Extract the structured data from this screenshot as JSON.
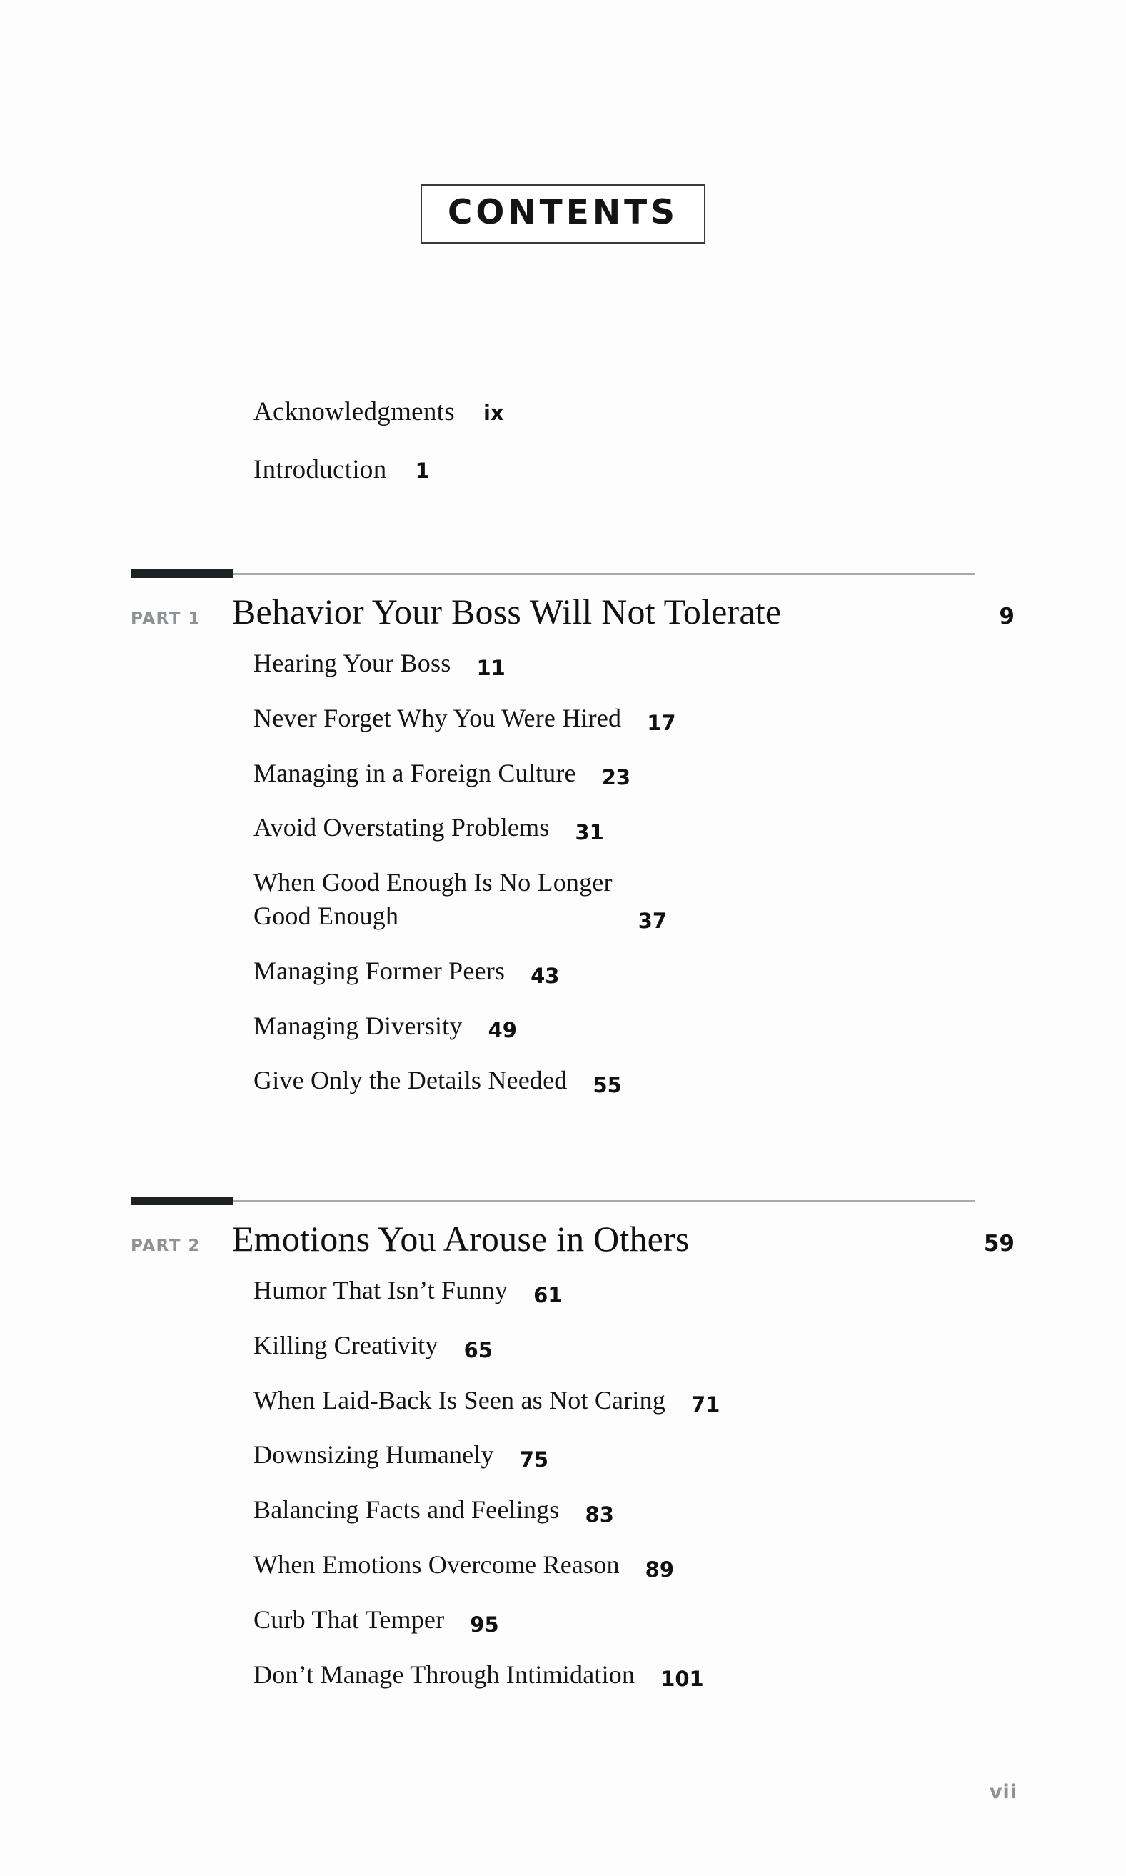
{
  "header": {
    "title": "CONTENTS"
  },
  "front_matter": [
    {
      "title": "Acknowledgments",
      "page": "ix"
    },
    {
      "title": "Introduction",
      "page": "1"
    }
  ],
  "parts": [
    {
      "label": "PART 1",
      "title": "Behavior Your Boss Will Not Tolerate",
      "page": "9",
      "chapters": [
        {
          "title": "Hearing Your Boss",
          "page": "11"
        },
        {
          "title": "Never Forget Why You Were Hired",
          "page": "17"
        },
        {
          "title": "Managing in a Foreign Culture",
          "page": "23"
        },
        {
          "title": "Avoid Overstating Problems",
          "page": "31"
        },
        {
          "title": "When Good Enough Is No Longer\nGood Enough",
          "page": "37"
        },
        {
          "title": "Managing Former Peers",
          "page": "43"
        },
        {
          "title": "Managing Diversity",
          "page": "49"
        },
        {
          "title": "Give Only the Details Needed",
          "page": "55"
        }
      ]
    },
    {
      "label": "PART 2",
      "title": "Emotions You Arouse in Others",
      "page": "59",
      "chapters": [
        {
          "title": "Humor That Isn’t Funny",
          "page": "61"
        },
        {
          "title": "Killing Creativity",
          "page": "65"
        },
        {
          "title": "When Laid-Back Is Seen as Not Caring",
          "page": "71"
        },
        {
          "title": "Downsizing Humanely",
          "page": "75"
        },
        {
          "title": "Balancing Facts and Feelings",
          "page": "83"
        },
        {
          "title": "When Emotions Overcome Reason",
          "page": "89"
        },
        {
          "title": "Curb That Temper",
          "page": "95"
        },
        {
          "title": "Don’t Manage Through Intimidation",
          "page": "101"
        }
      ]
    }
  ],
  "footer": {
    "folio": "vii"
  },
  "colors": {
    "text": "#111111",
    "part_label": "#8e9294",
    "rule_thick": "#1c2224",
    "rule_thin": "#a9a9a9",
    "folio": "#8e9294"
  }
}
